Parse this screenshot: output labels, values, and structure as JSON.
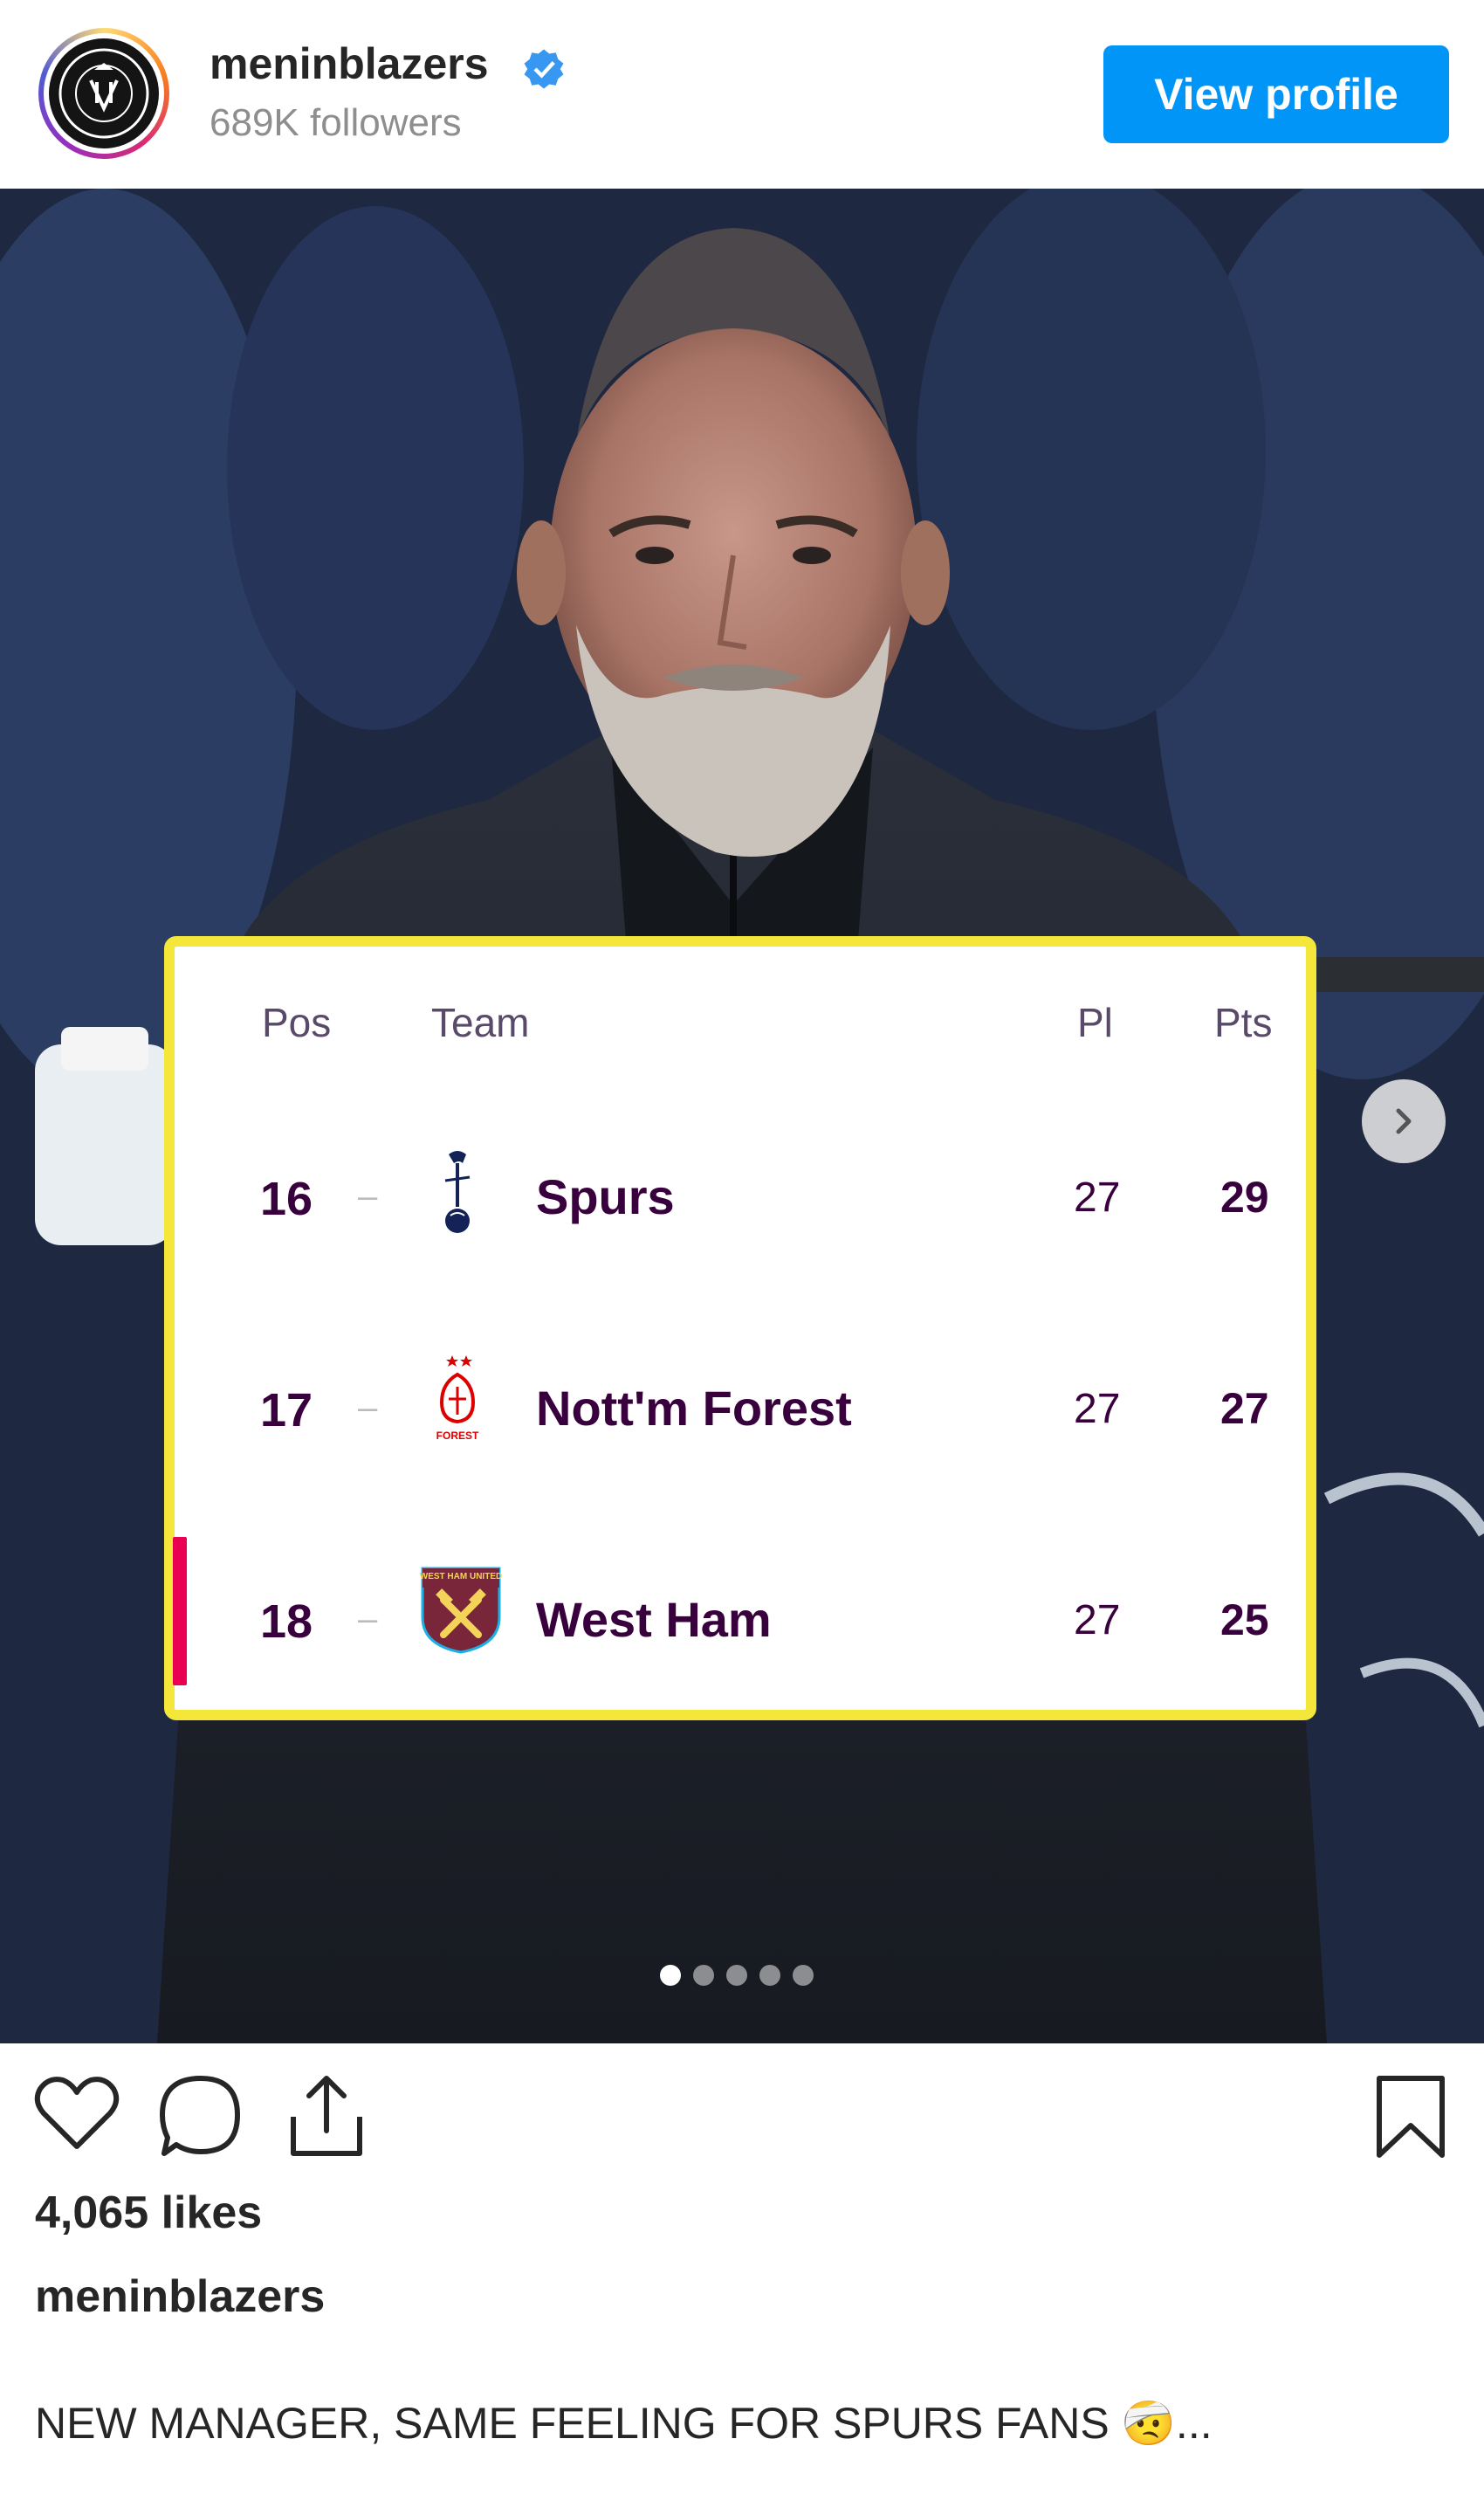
{
  "header": {
    "username": "meninblazers",
    "followers": "689K followers",
    "view_profile_label": "View profile",
    "avatar_logo_text": "MEN IN BLAZERS COURAGE"
  },
  "table": {
    "columns": {
      "pos": "Pos",
      "team": "Team",
      "pl": "Pl",
      "pts": "Pts"
    },
    "rows": [
      {
        "pos": "16",
        "dash": "–",
        "team": "Spurs",
        "pl": "27",
        "pts": "29",
        "crest": "spurs-crest-icon"
      },
      {
        "pos": "17",
        "dash": "–",
        "team": "Nott'm Forest",
        "pl": "27",
        "pts": "27",
        "crest": "forest-crest-icon"
      },
      {
        "pos": "18",
        "dash": "–",
        "team": "West Ham",
        "pl": "27",
        "pts": "25",
        "crest": "westham-crest-icon"
      }
    ],
    "crest_labels": {
      "forest": "FOREST",
      "westham": "WEST HAM UNITED"
    }
  },
  "carousel": {
    "current": 1,
    "total": 5
  },
  "post": {
    "likes": "4,065 likes",
    "caption_user": "meninblazers",
    "caption_text": "NEW MANAGER, SAME FEELING FOR SPURS FANS",
    "caption_emoji": "🤕",
    "caption_more": "..."
  },
  "colors": {
    "accent": "#0095f6",
    "highlight_border": "#f5e63a",
    "pl_purple": "#38003c",
    "relegation": "#e90052"
  }
}
